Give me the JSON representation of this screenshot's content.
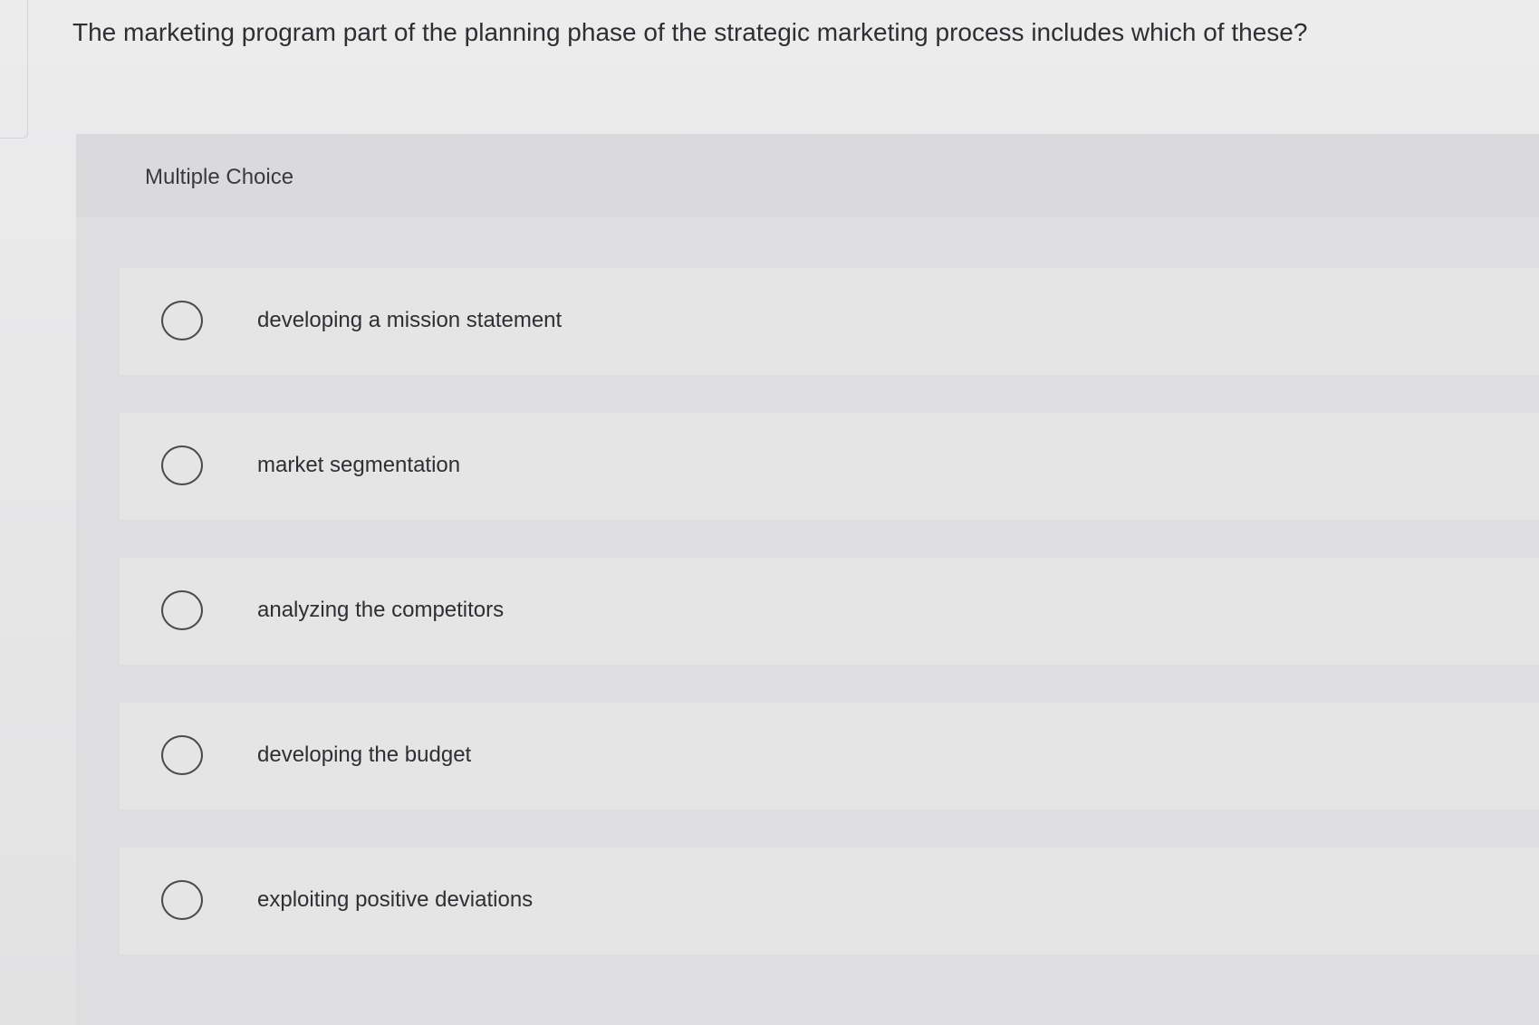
{
  "question": {
    "text": "The marketing program part of the planning phase of the strategic marketing process includes which of these?"
  },
  "choice_section": {
    "label": "Multiple Choice",
    "options": [
      {
        "label": "developing a mission statement",
        "selected": false
      },
      {
        "label": "market segmentation",
        "selected": false
      },
      {
        "label": "analyzing the competitors",
        "selected": false
      },
      {
        "label": "developing the budget",
        "selected": false
      },
      {
        "label": "exploiting positive deviations",
        "selected": false
      }
    ]
  }
}
